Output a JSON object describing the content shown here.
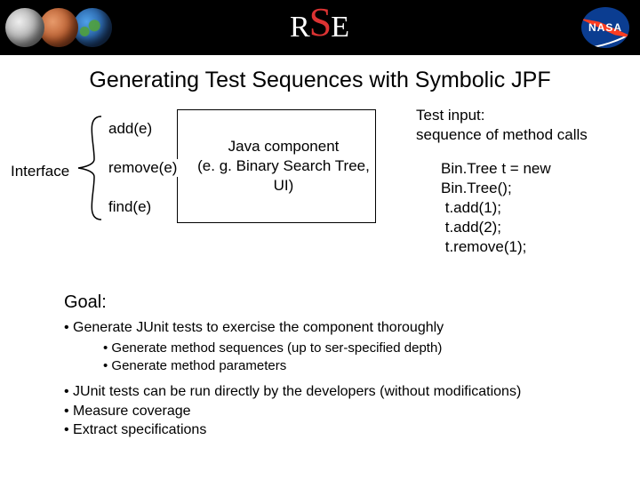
{
  "banner": {
    "logo_text_left": "R",
    "logo_text_mid": "S",
    "logo_text_right": "E",
    "nasa_text": "NASA"
  },
  "title": "Generating Test Sequences with Symbolic JPF",
  "diagram": {
    "interface_label": "Interface",
    "methods": {
      "add": "add(e)",
      "remove": "remove(e)",
      "find": "find(e)"
    },
    "box": {
      "line1": "Java component",
      "line2": "(e. g. Binary Search Tree,",
      "line3": "UI)"
    },
    "test_input_heading_l1": "Test input:",
    "test_input_heading_l2": "sequence of method calls",
    "code": "Bin.Tree t = new\nBin.Tree();\n t.add(1);\n t.add(2);\n t.remove(1);"
  },
  "goal": {
    "heading": "Goal:",
    "b1": "Generate JUnit tests to exercise the component thoroughly",
    "s1": "Generate method sequences (up to ser-specified depth)",
    "s2": "Generate method parameters",
    "b2": "JUnit tests can be run directly by the developers (without modifications)",
    "b3": "Measure coverage",
    "b4": "Extract specifications"
  }
}
